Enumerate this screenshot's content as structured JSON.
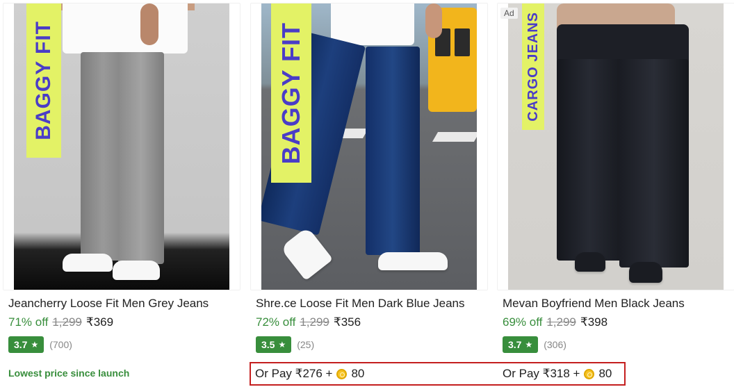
{
  "products": [
    {
      "badge": "BAGGY FIT",
      "title": "Jeancherry Loose Fit Men Grey Jeans",
      "discount": "71% off",
      "mrp": "1,299",
      "price": "₹369",
      "rating": "3.7",
      "rating_count": "(700)",
      "tagline": "Lowest price since launch"
    },
    {
      "badge": "BAGGY FIT",
      "title": "Shre.ce Loose Fit Men Dark Blue Jeans",
      "discount": "72% off",
      "mrp": "1,299",
      "price": "₹356",
      "rating": "3.5",
      "rating_count": "(25)",
      "pay_option": {
        "text": "Or Pay ₹276 +",
        "coins": "80"
      }
    },
    {
      "ad_label": "Ad",
      "badge": "CARGO JEANS",
      "title": "Mevan Boyfriend Men Black Jeans",
      "discount": "69% off",
      "mrp": "1,299",
      "price": "₹398",
      "rating": "3.7",
      "rating_count": "(306)",
      "pay_option": {
        "text": "Or Pay ₹318 +",
        "coins": "80"
      }
    }
  ],
  "colors": {
    "discount_green": "#388e3c",
    "rating_green": "#388e3c",
    "highlight_border": "#c41e1e",
    "badge_bg": "#e3f266",
    "badge_text": "#4a3cc7"
  },
  "icons": {
    "rating": "star-icon",
    "coin": "supercoin-icon"
  }
}
